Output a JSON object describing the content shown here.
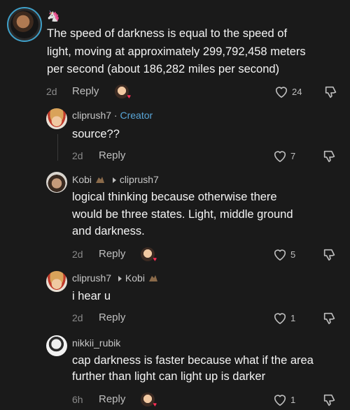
{
  "top_comment": {
    "emoji": "🦄",
    "lines": [
      "The speed of darkness is equal to the speed of",
      "light, moving at approximately 299,792,458 meters",
      "per second (about 186,282 miles per second)"
    ],
    "age": "2d",
    "reply_label": "Reply",
    "likes": "24"
  },
  "replies": [
    {
      "author": "cliprush7",
      "separator": "·",
      "badge": "Creator",
      "lines": [
        "source??"
      ],
      "age": "2d",
      "reply_label": "Reply",
      "likes": "7"
    },
    {
      "author": "Kobi",
      "reply_to": "cliprush7",
      "lines": [
        "logical thinking because otherwise there",
        "would be three states. Light, middle ground",
        "and darkness."
      ],
      "age": "2d",
      "reply_label": "Reply",
      "likes": "5"
    },
    {
      "author": "cliprush7",
      "reply_to": "Kobi",
      "lines": [
        "i hear u"
      ],
      "age": "2d",
      "reply_label": "Reply",
      "likes": "1"
    },
    {
      "author": "nikkii_rubik",
      "lines": [
        "cap darkness is faster because what if the area",
        "further than light can light up is darker"
      ],
      "age": "6h",
      "reply_label": "Reply",
      "likes": "1"
    }
  ],
  "icons": {
    "like": "heart-outline-icon",
    "dislike": "thumbs-down-icon",
    "creator_liked": "creator-liked-avatar-icon"
  },
  "colors": {
    "background": "#1a1a1a",
    "creator_badge": "#59a6d8",
    "avatar_ring": "#3fa0c9"
  }
}
